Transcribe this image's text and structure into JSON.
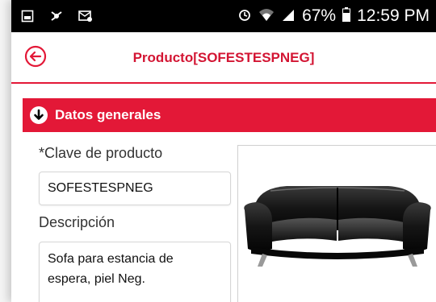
{
  "status_bar": {
    "battery_percent": "67%",
    "time": "12:59 PM"
  },
  "app_bar": {
    "title": "Producto[SOFESTESPNEG]"
  },
  "section": {
    "label": "Datos generales"
  },
  "form": {
    "clave_label": "*Clave de producto",
    "clave_value": "SOFESTESPNEG",
    "descripcion_label": "Descripción",
    "descripcion_value_line1": "Sofa para estancia de",
    "descripcion_value_line2": "espera, piel Neg."
  },
  "colors": {
    "accent": "#e31837",
    "title": "#d31533"
  }
}
